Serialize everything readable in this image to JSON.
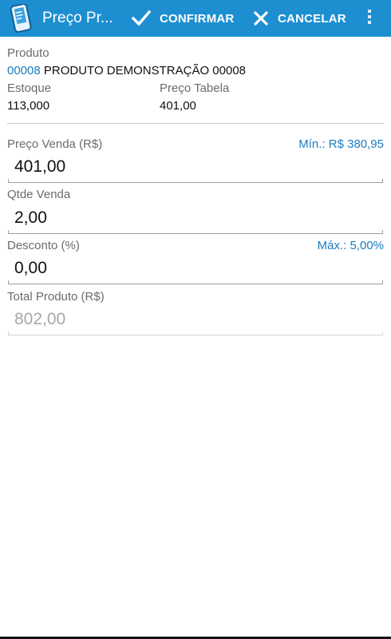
{
  "actionbar": {
    "title": "Preço Pr...",
    "confirm_label": "CONFIRMAR",
    "cancel_label": "CANCELAR",
    "color": "#1d8fd1"
  },
  "produto": {
    "label": "Produto",
    "code": "00008",
    "name": "PRODUTO DEMONSTRAÇÃO 00008"
  },
  "estoque": {
    "label": "Estoque",
    "value": "113,000"
  },
  "preco_tabela": {
    "label": "Preço Tabela",
    "value": "401,00"
  },
  "preco_venda": {
    "label": "Preço Venda (R$)",
    "hint": "Mín.: R$ 380,95",
    "value": "401,00"
  },
  "qtde_venda": {
    "label": "Qtde Venda",
    "value": "2,00"
  },
  "desconto": {
    "label": "Desconto (%)",
    "hint": "Máx.: 5,00%",
    "value": "0,00"
  },
  "total_produto": {
    "label": "Total Produto (R$)",
    "value": "802,00"
  },
  "icons": [
    "app-icon",
    "check-icon",
    "close-icon",
    "overflow-menu-icon"
  ],
  "accent_color": "#1a7cc0"
}
